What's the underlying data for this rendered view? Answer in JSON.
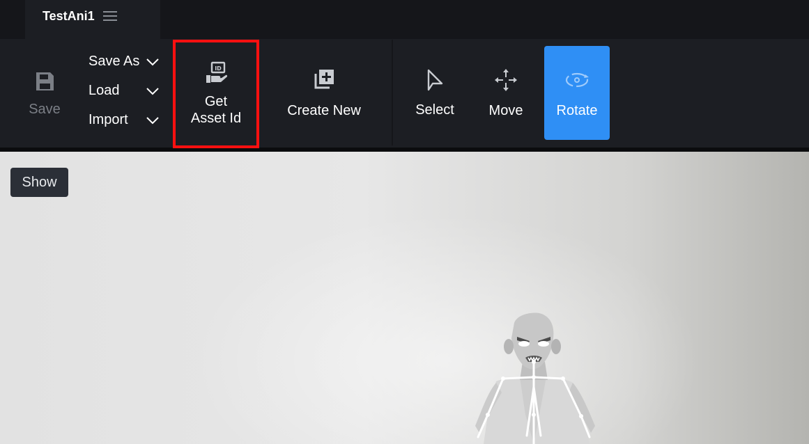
{
  "title_bar": {
    "document_tab": {
      "name": "TestAni1",
      "menu_icon": "hamburger-menu-icon"
    }
  },
  "toolbar": {
    "save": {
      "label": "Save",
      "icon": "floppy-disk-icon",
      "state": "disabled"
    },
    "file_menu": [
      {
        "label": "Save As",
        "icon": "chevron-down-icon"
      },
      {
        "label": "Load",
        "icon": "chevron-down-icon"
      },
      {
        "label": "Import",
        "icon": "chevron-down-icon"
      }
    ],
    "get_asset_id": {
      "label_line1": "Get",
      "label_line2": "Asset Id",
      "icon": "id-card-hand-icon",
      "highlight_color": "#ff1010"
    },
    "create_new": {
      "label": "Create New",
      "icon": "library-add-icon"
    },
    "tools": [
      {
        "label": "Select",
        "icon": "cursor-arrow-icon",
        "active": false
      },
      {
        "label": "Move",
        "icon": "move-arrows-icon",
        "active": false
      },
      {
        "label": "Rotate",
        "icon": "rotate-icon",
        "active": true
      }
    ]
  },
  "viewport": {
    "show_button": "Show"
  },
  "colors": {
    "titlebar": "#15161a",
    "toolbar": "#1c1e23",
    "active_tool": "#2f8ff5",
    "disabled_text": "#7b7f86"
  }
}
